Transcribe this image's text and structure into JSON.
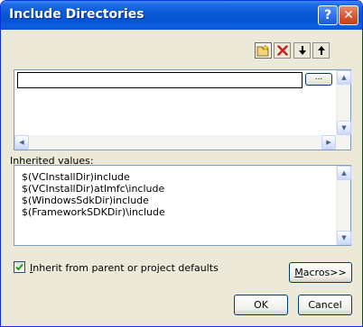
{
  "window": {
    "title": "Include Directories"
  },
  "titlebar": {
    "help_glyph": "?",
    "close_glyph": "✕"
  },
  "toolbar": {
    "icons": [
      "new-folder-icon",
      "delete-icon",
      "move-down-icon",
      "move-up-icon"
    ],
    "delete_color": "#c81e1e"
  },
  "editor": {
    "current_value": "",
    "browse_label": "..."
  },
  "inherited": {
    "label": "Inherited values:",
    "lines": [
      "$(VCInstallDir)include",
      "$(VCInstallDir)atlmfc\\include",
      "$(WindowsSdkDir)include",
      "$(FrameworkSDKDir)\\include"
    ]
  },
  "options": {
    "inherit_checked": true,
    "inherit_label_first": "I",
    "inherit_label_rest": "nherit from parent or project defaults"
  },
  "buttons": {
    "macros_first": "M",
    "macros_rest": "acros>>",
    "ok": "OK",
    "cancel": "Cancel"
  }
}
